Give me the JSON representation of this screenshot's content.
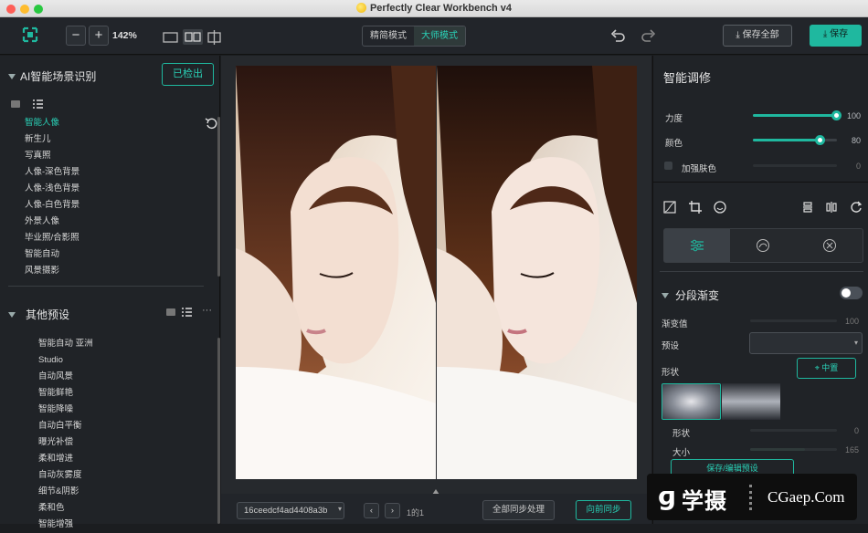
{
  "window": {
    "title": "Perfectly Clear Workbench v4"
  },
  "toolbar": {
    "zoom_out": "−",
    "zoom_in": "+",
    "zoom_level": "142%",
    "mode_simple": "精简模式",
    "mode_master": "大师模式",
    "save_all": "保存全部",
    "save": "保存"
  },
  "left": {
    "ai_title": "AI智能场景识别",
    "detected": "已检出",
    "scenes": [
      "智能人像",
      "新生儿",
      "写真照",
      "人像-深色背景",
      "人像-浅色背景",
      "人像-白色背景",
      "外景人像",
      "毕业照/合影照",
      "智能自动",
      "风景摄影"
    ],
    "presets_title": "其他预设",
    "presets": [
      "智能自动 亚洲",
      "Studio",
      "自动风景",
      "智能鲜艳",
      "智能降噪",
      "自动白平衡",
      "曝光补偿",
      "柔和增进",
      "自动灰雾度",
      "细节&阴影",
      "柔和色",
      "智能增强"
    ]
  },
  "bottom": {
    "filename": "16ceedcf4ad4408a3b",
    "page": "1的1",
    "sync_all": "全部同步处理",
    "sync_forward": "向前同步"
  },
  "right": {
    "title": "智能调修",
    "strength_label": "力度",
    "strength_value": "100",
    "strength_level": 1.0,
    "color_label": "颜色",
    "color_value": "80",
    "color_level": 0.8,
    "skin_label": "加强肤色",
    "skin_value": "0",
    "section": "分段渐变",
    "grad_label": "渐变值",
    "grad_value": "100",
    "preset_label": "预设",
    "shape_label": "形状",
    "center_btn": "中置",
    "shape2_label": "形状",
    "shape2_value": "0",
    "size_label": "大小",
    "size_value": "165",
    "save_preset": "保存/编辑预设"
  },
  "watermark": {
    "logo": "学摄",
    "site": "CGaep.Com"
  },
  "colors": {
    "accent": "#1fb89f",
    "bg": "#1b1d20"
  }
}
